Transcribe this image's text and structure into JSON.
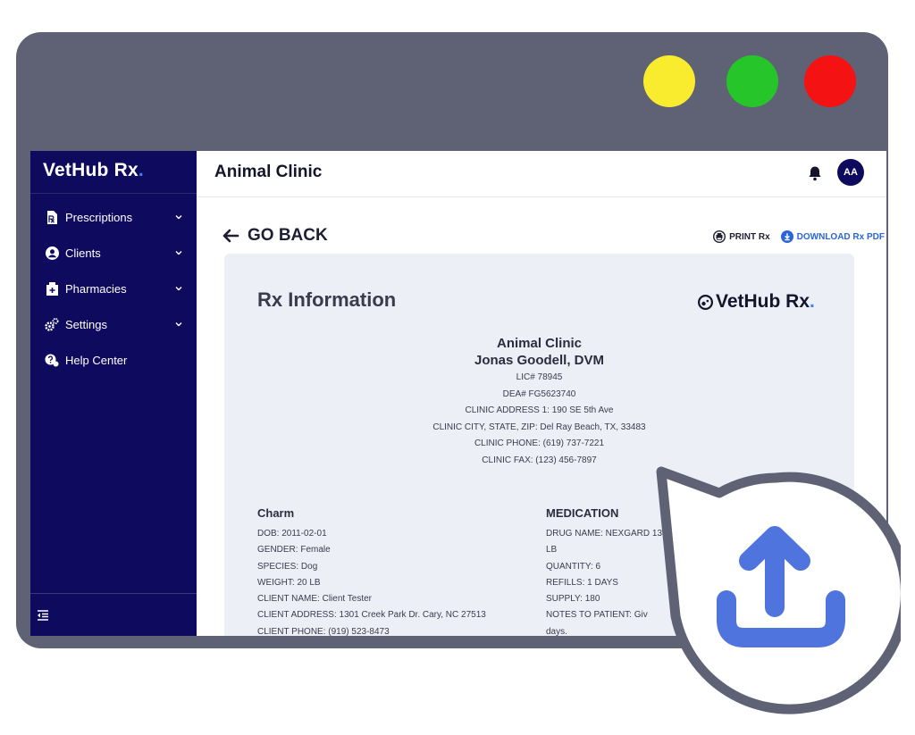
{
  "window": {
    "controls": [
      "minimize",
      "maximize",
      "close"
    ]
  },
  "sidebar": {
    "brand": "VetHub Rx",
    "brand_accent": ".",
    "items": [
      {
        "label": "Prescriptions",
        "icon": "prescription-icon",
        "expandable": true
      },
      {
        "label": "Clients",
        "icon": "user-circle-icon",
        "expandable": true
      },
      {
        "label": "Pharmacies",
        "icon": "pharmacy-icon",
        "expandable": true
      },
      {
        "label": "Settings",
        "icon": "gears-icon",
        "expandable": true
      },
      {
        "label": "Help Center",
        "icon": "help-center-icon",
        "expandable": false
      }
    ]
  },
  "header": {
    "title": "Animal Clinic",
    "avatar_initials": "AA"
  },
  "main": {
    "go_back": "GO BACK",
    "print_label": "PRINT Rx",
    "download_label": "DOWNLOAD Rx PDF"
  },
  "rx": {
    "title": "Rx Information",
    "logo_text": "VetHub Rx",
    "logo_accent": ".",
    "clinic_name": "Animal Clinic",
    "vet_name": "Jonas Goodell, DVM",
    "clinic_lines": [
      "LIC# 78945",
      "DEA# FG5623740",
      "CLINIC ADDRESS 1: 190 SE 5th Ave",
      "CLINIC CITY, STATE, ZIP: Del Ray Beach, TX, 33483",
      "CLINIC PHONE: (619) 737-7221",
      "CLINIC FAX: (123) 456-7897"
    ],
    "patient": {
      "name": "Charm",
      "lines": [
        "DOB: 2011-02-01",
        "GENDER: Female",
        "SPECIES: Dog",
        "WEIGHT: 20 LB",
        "CLIENT NAME: Client Tester",
        "CLIENT ADDRESS: 1301 Creek Park Dr. Cary, NC 27513",
        "CLIENT PHONE: (919) 523-8473"
      ]
    },
    "medication": {
      "heading": "MEDICATION",
      "lines": [
        "DRUG NAME: NEXGARD 13",
        "LB",
        "QUANTITY: 6",
        "REFILLS: 1 DAYS",
        "SUPPLY: 180",
        "NOTES TO PATIENT: Giv",
        "days."
      ]
    }
  },
  "colors": {
    "frame": "#5f6275",
    "sidebar": "#0e0b5e",
    "accent": "#3f7ff2",
    "card": "#edeff6",
    "upload_icon": "#4f74de",
    "dot_yellow": "#f9ec2f",
    "dot_green": "#26c62a",
    "dot_red": "#f41212"
  },
  "overlay": {
    "icon": "upload-icon"
  }
}
